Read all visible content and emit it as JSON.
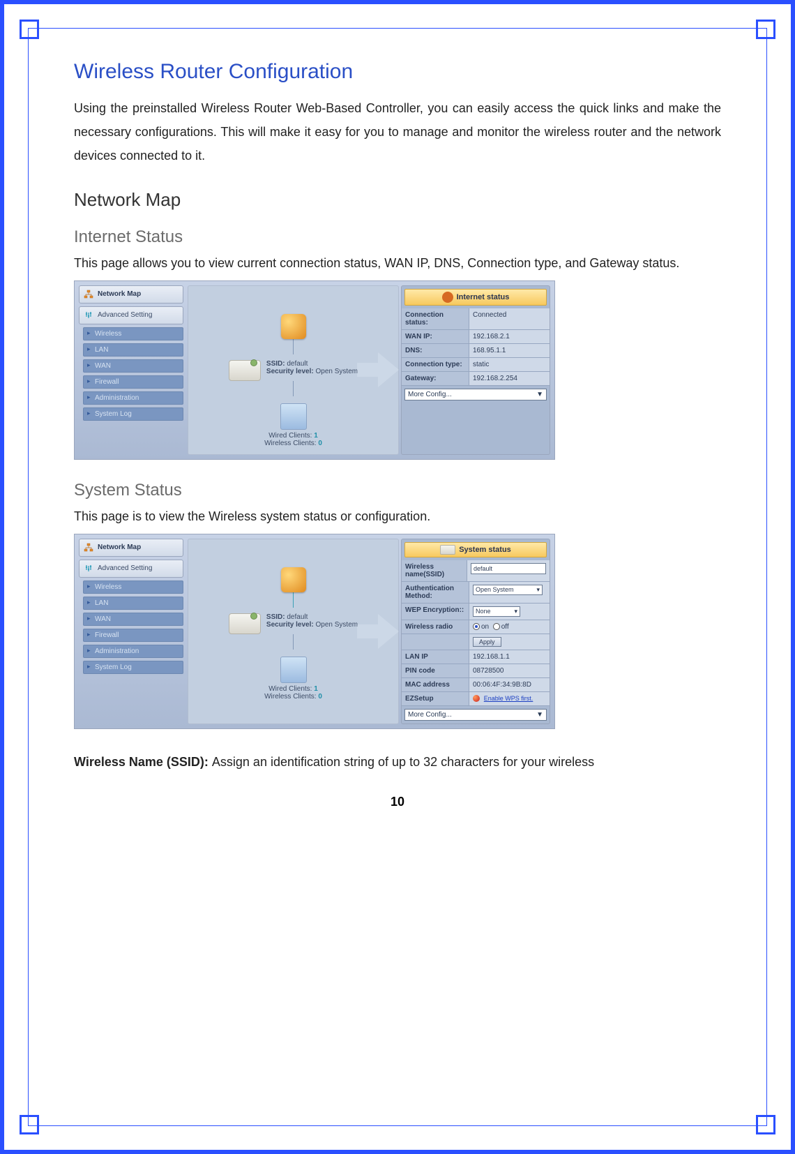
{
  "title": "Wireless Router Configuration",
  "intro": "Using the preinstalled Wireless Router Web-Based Controller, you can easily access the quick links and make the necessary configurations. This will make it easy for you to manage and monitor the wireless router and the network devices connected to it.",
  "section_network_map": "Network Map",
  "subsection_internet_status": "Internet Status",
  "internet_status_desc": "This page allows you to view current connection status, WAN IP, DNS, Connection type, and Gateway status.",
  "subsection_system_status": "System Status",
  "system_status_desc": "This page is to view the Wireless system status or configuration.",
  "ssid_def_label": "Wireless Name (SSID): ",
  "ssid_def_text": "Assign an identification string of up to 32 characters for your wireless",
  "page_number": "10",
  "sidebar": {
    "network_map": "Network Map",
    "advanced_setting": "Advanced Setting",
    "items": [
      "Wireless",
      "LAN",
      "WAN",
      "Firewall",
      "Administration",
      "System Log"
    ]
  },
  "map": {
    "ssid_label": "SSID:",
    "ssid_value": "default",
    "sec_label": "Security level:",
    "sec_value": "Open System",
    "wired_label": "Wired Clients:",
    "wired_count": "1",
    "wireless_label": "Wireless Clients:",
    "wireless_count": "0"
  },
  "internet_panel": {
    "header": "Internet status",
    "rows": [
      {
        "label": "Connection status:",
        "value": "Connected"
      },
      {
        "label": "WAN IP:",
        "value": "192.168.2.1"
      },
      {
        "label": "DNS:",
        "value": "168.95.1.1"
      },
      {
        "label": "Connection type:",
        "value": "static"
      },
      {
        "label": "Gateway:",
        "value": "192.168.2.254"
      }
    ],
    "more_config": "More Config..."
  },
  "system_panel": {
    "header": "System status",
    "ssid_label": "Wireless name(SSID)",
    "ssid_value": "default",
    "auth_label": "Authentication Method:",
    "auth_value": "Open System",
    "wep_label": "WEP Encryption::",
    "wep_value": "None",
    "radio_label": "Wireless radio",
    "radio_on": "on",
    "radio_off": "off",
    "apply": "Apply",
    "lan_ip_label": "LAN IP",
    "lan_ip_value": "192.168.1.1",
    "pin_label": "PIN code",
    "pin_value": "08728500",
    "mac_label": "MAC address",
    "mac_value": "00:06:4F:34:9B:8D",
    "ez_label": "EZSetup",
    "ez_link": "Enable WPS first.",
    "more_config": "More Config..."
  }
}
